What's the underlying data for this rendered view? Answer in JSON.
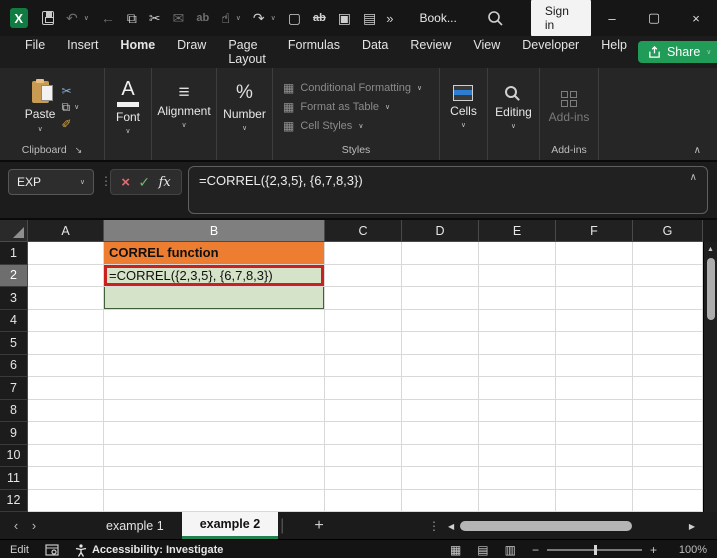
{
  "titlebar": {
    "app_letter": "X",
    "title": "Book...",
    "sign_in": "Sign in",
    "overflow": "»",
    "window_controls": {
      "minimize": "–",
      "maximize": "▢",
      "close": "×"
    },
    "qat_icons": [
      {
        "name": "undo-icon",
        "glyph": "↶",
        "chevron": true,
        "dim": true
      },
      {
        "name": "back-arrow-icon",
        "glyph": "←",
        "dim": true
      },
      {
        "name": "copy-icon",
        "glyph": "⧉"
      },
      {
        "name": "cut-icon",
        "glyph": "✂"
      },
      {
        "name": "email-icon",
        "glyph": "✉",
        "dim": true
      },
      {
        "name": "replace-icon",
        "glyph": "ab",
        "dim": true,
        "small": true
      },
      {
        "name": "touch-mode-icon",
        "glyph": "☝",
        "chevron": true
      },
      {
        "name": "redo-icon",
        "glyph": "↷",
        "chevron": true
      },
      {
        "name": "new-file-icon",
        "glyph": "▢"
      },
      {
        "name": "strikethrough-icon",
        "glyph": "ab",
        "small": true,
        "strike": true
      },
      {
        "name": "camera-icon",
        "glyph": "▣"
      },
      {
        "name": "book-search-icon",
        "glyph": "▤"
      }
    ]
  },
  "menubar": {
    "tabs": [
      {
        "label": "File"
      },
      {
        "label": "Insert"
      },
      {
        "label": "Home",
        "active": true
      },
      {
        "label": "Draw"
      },
      {
        "label": "Page Layout"
      },
      {
        "label": "Formulas"
      },
      {
        "label": "Data"
      },
      {
        "label": "Review"
      },
      {
        "label": "View"
      },
      {
        "label": "Developer"
      },
      {
        "label": "Help"
      }
    ],
    "share": "Share"
  },
  "ribbon": {
    "paste": "Paste",
    "clipboard_group": "Clipboard",
    "cut_glyph": "✂",
    "copy_glyph": "⧉",
    "painter_glyph": "✐",
    "font_button": "Font",
    "font_glyph": "A",
    "alignment_button": "Alignment",
    "alignment_glyph": "≡",
    "number_button": "Number",
    "number_glyph": "%",
    "styles_items": [
      "Conditional Formatting",
      "Format as Table",
      "Cell Styles"
    ],
    "styles_group": "Styles",
    "cells_button": "Cells",
    "editing_button": "Editing",
    "addins_button": "Add-ins",
    "addins_group": "Add-ins"
  },
  "formula_bar": {
    "name_box": "EXP",
    "cancel": "×",
    "enter": "✓",
    "fx": "fx",
    "formula": "=CORREL({2,3,5}, {6,7,8,3})"
  },
  "grid": {
    "columns": [
      "A",
      "B",
      "C",
      "D",
      "E",
      "F",
      "G"
    ],
    "rows": [
      1,
      2,
      3,
      4,
      5,
      6,
      7,
      8,
      9,
      10,
      11,
      12
    ],
    "selected_column": "B",
    "selected_row": 2,
    "cells": {
      "B1": {
        "text": "CORREL function",
        "bg": "#ED7D31",
        "bold": true
      },
      "B2": {
        "text": "=CORREL({2,3,5}, {6,7,8,3})",
        "bg": "#D5E3C8",
        "red_border": true
      },
      "B3": {
        "text": "",
        "bg": "#D5E3C8",
        "sel_border": true
      }
    }
  },
  "sheetbar": {
    "tabs": [
      {
        "label": "example 1"
      },
      {
        "label": "example 2",
        "active": true
      }
    ],
    "add": "+",
    "separator": "|"
  },
  "statusbar": {
    "mode": "Edit",
    "accessibility": "Accessibility: Investigate",
    "view_icons": [
      "▦",
      "▤",
      "▥"
    ],
    "zoom_minus": "−",
    "zoom_plus": "+",
    "zoom": "100%"
  },
  "ui": {
    "chevron_down": "∨",
    "chevron_up": "∧",
    "dots_vertical": "⋮",
    "launcher": "↘",
    "nav_left": "‹",
    "nav_right": "›",
    "scroll_left": "◀",
    "scroll_right": "▶",
    "scroll_up": "▲",
    "mini_table": "▦"
  },
  "colors": {
    "accent_green": "#21A366",
    "orange_fill": "#ED7D31",
    "green_fill": "#D5E3C8",
    "red_border": "#C9211E",
    "selected_header": "#7F7F7F"
  }
}
